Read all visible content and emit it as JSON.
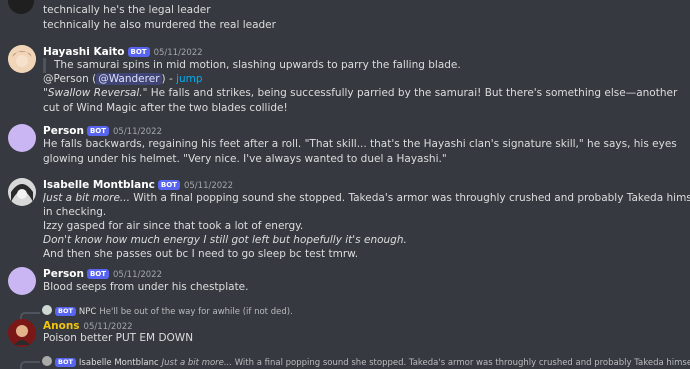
{
  "top_lines": [
    "technically he's the legal leader",
    "technically he also murdered the real leader"
  ],
  "bot_badge": "BOT",
  "msg_hayashi": {
    "author": "Hayashi Kaito",
    "timestamp": "05/11/2022",
    "quote": "The samurai spins in mid motion, slashing upwards to parry the falling blade.",
    "mention_prefix": "@Person (",
    "mention": "@Wanderer",
    "mention_suffix": ") -",
    "jump": "jump",
    "italic": "\"Swallow Reversal.\"",
    "body": " He falls and strikes, being successfully parried by the samurai! But there's something else—another cut of Wind Magic after the two blades collide!"
  },
  "msg_person1": {
    "author": "Person",
    "timestamp": "05/11/2022",
    "body": "He falls backwards, regaining his feet after a roll. \"That skill... that's the Hayashi clan's signature skill,\" he says, his eyes glowing under his helmet. \"Very nice. I've always wanted to duel a Hayashi.\""
  },
  "msg_isabelle": {
    "author": "Isabelle Montblanc",
    "timestamp": "05/11/2022",
    "line1_italic": "Just a bit more...",
    "line1_rest": " With a final popping sound she stopped. Takeda's armor was throughly crushed and probably Takeda himself too, but he wasn't moving so no point",
    "line2": "in checking.",
    "line3": "Izzy gasped for air since that took a lot of energy.",
    "line4_italic": "Don't know how much energy I still got left but hopefully it's enough.",
    "line5": "And then she passes out bc I need to go sleep bc test tmrw."
  },
  "msg_person2": {
    "author": "Person",
    "timestamp": "05/11/2022",
    "body": "Blood seeps from under his chestplate."
  },
  "msg_anons": {
    "reply_name": "NPC",
    "reply_text": "He'll be out of the way for awhile (if not ded).",
    "author": "Anons",
    "timestamp": "05/11/2022",
    "body": "Poison better PUT EM DOWN"
  },
  "bottom_reply": {
    "name": "Isabelle Montblanc",
    "italic": "Just a bit more...",
    "text": " With a final popping sound she stopped. Takeda's armor was throughly crushed and probably Takeda himself too, but he wasn't moving so no"
  }
}
